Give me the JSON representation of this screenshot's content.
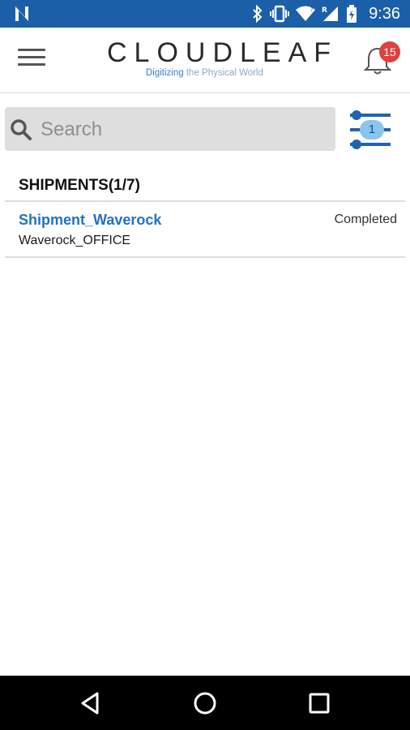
{
  "status_bar": {
    "time": "9:36",
    "icons": [
      "notification-n-icon",
      "bluetooth-icon",
      "vibrate-icon",
      "wifi-icon",
      "signal-icon",
      "battery-icon"
    ]
  },
  "app_bar": {
    "brand": "CLOUDLEAF",
    "tagline_accent": "Digitizing",
    "tagline_rest": " the Physical World",
    "notification_count": "15"
  },
  "search": {
    "placeholder": "Search",
    "value": ""
  },
  "filter": {
    "count": "1"
  },
  "list": {
    "header": "SHIPMENTS(1/7)",
    "items": [
      {
        "name": "Shipment_Waverock",
        "location": "Waverock_OFFICE",
        "status": "Completed"
      }
    ]
  },
  "colors": {
    "status_bar": "#1b5fa8",
    "accent_blue": "#2471c1",
    "badge_red": "#e0413e",
    "filter_badge": "#89c5ec"
  }
}
